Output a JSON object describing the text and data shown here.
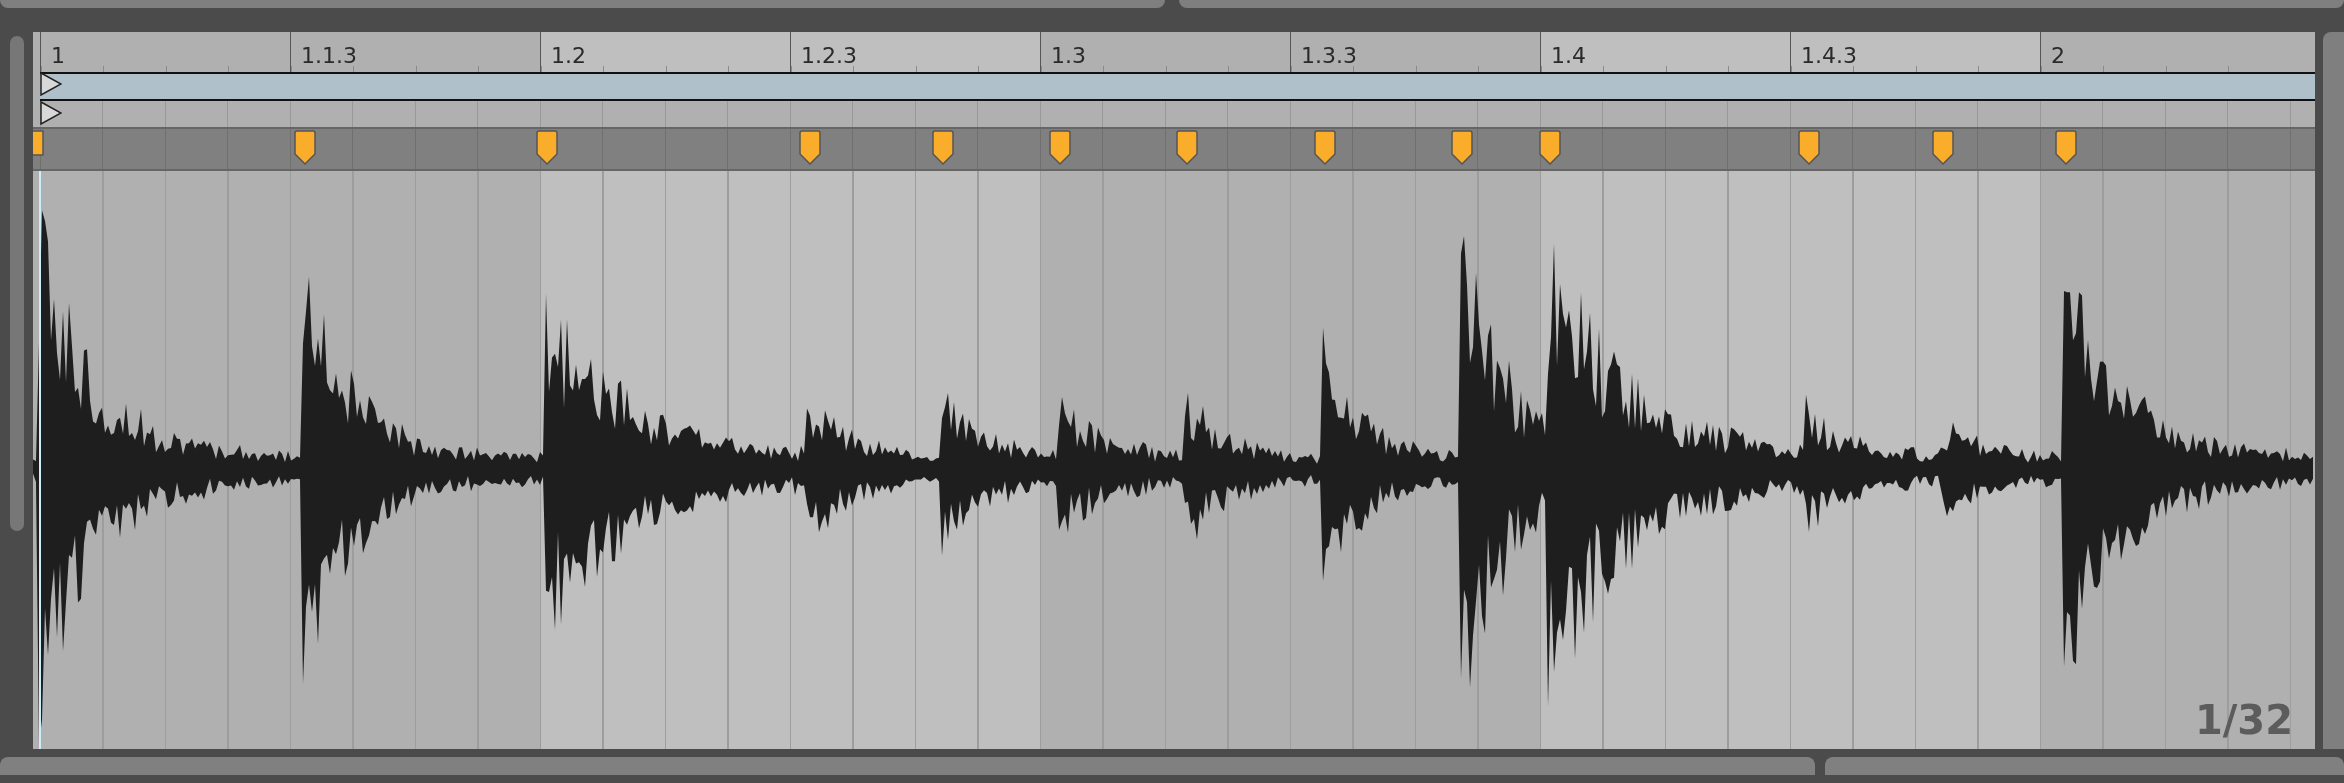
{
  "ruler": {
    "labels": [
      "1",
      "1.1.3",
      "1.2",
      "1.2.3",
      "1.3",
      "1.3.3",
      "1.4",
      "1.4.3",
      "2"
    ]
  },
  "grid": {
    "zoom_label": "1/32"
  }
}
